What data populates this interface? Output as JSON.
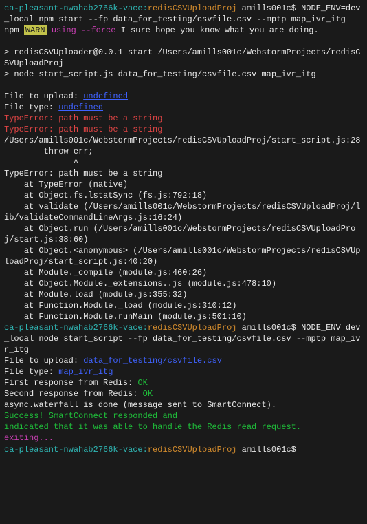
{
  "prompt1": {
    "host": "ca-pleasant-nwahab2766k-vace",
    "dir": "redisCSVUploadProj",
    "user": "amills001c$",
    "cmd_part1": "NODE_ENV=dev_local npm start --fp data_for_testing/csvfile.csv --mptp map_ivr_itg"
  },
  "npm_warn": {
    "npm": "npm",
    "warn": "WARN",
    "flag": "using --force",
    "msg": " I sure hope you know what you are doing."
  },
  "start_banner": {
    "line1": "> redisCSVUploader@0.0.1 start /Users/amills001c/WebstormProjects/redisCSVUploadProj",
    "line2": "> node start_script.js data_for_testing/csvfile.csv map_ivr_itg"
  },
  "run1": {
    "file_to_upload_label": "File to upload: ",
    "file_to_upload_value": "undefined",
    "file_type_label": "File type: ",
    "file_type_value": "undefined",
    "typeerr1": "TypeError: path must be a string",
    "typeerr2": "TypeError: path must be a string",
    "trace0": "/Users/amills001c/WebstormProjects/redisCSVUploadProj/start_script.js:28",
    "trace_throw": "        throw err;",
    "trace_caret": "              ^",
    "trace_head": "TypeError: path must be a string",
    "t1": "    at TypeError (native)",
    "t2": "    at Object.fs.lstatSync (fs.js:792:18)",
    "t3": "    at validate (/Users/amills001c/WebstormProjects/redisCSVUploadProj/lib/validateCommandLineArgs.js:16:24)",
    "t4": "    at Object.run (/Users/amills001c/WebstormProjects/redisCSVUploadProj/start.js:38:60)",
    "t5": "    at Object.<anonymous> (/Users/amills001c/WebstormProjects/redisCSVUploadProj/start_script.js:40:20)",
    "t6": "    at Module._compile (module.js:460:26)",
    "t7": "    at Object.Module._extensions..js (module.js:478:10)",
    "t8": "    at Module.load (module.js:355:32)",
    "t9": "    at Function.Module._load (module.js:310:12)",
    "t10": "    at Function.Module.runMain (module.js:501:10)"
  },
  "prompt2": {
    "host": "ca-pleasant-nwahab2766k-vace",
    "dir": "redisCSVUploadProj",
    "user": "amills001c$",
    "cmd": "NODE_ENV=dev_local node start_script --fp data_for_testing/csvfile.csv --mptp map_ivr_itg"
  },
  "run2": {
    "file_to_upload_label": "File to upload: ",
    "file_to_upload_value": "data_for_testing/csvfile.csv",
    "file_type_label": "File type: ",
    "file_type_value": "map_ivr_itg",
    "first_resp_label": "First response from Redis: ",
    "first_resp_value": "OK",
    "second_resp_label": "Second response from Redis: ",
    "second_resp_value": "OK",
    "waterfall": "async.waterfall is done (message sent to SmartConnect).",
    "success1": "Success! SmartConnect responded and",
    "success2": "indicated that it was able to handle the Redis read request.",
    "exiting": "exiting..."
  },
  "prompt3": {
    "host": "ca-pleasant-nwahab2766k-vace",
    "dir": "redisCSVUploadProj",
    "user": "amills001c$"
  }
}
